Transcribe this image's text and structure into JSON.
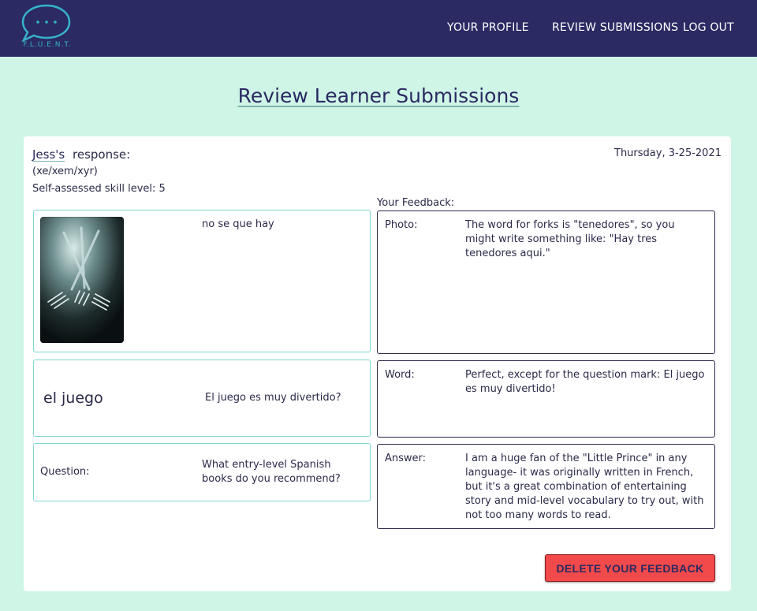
{
  "brand": {
    "logo_text": "F.L.U.E.N.T."
  },
  "nav": {
    "profile": "YOUR PROFILE",
    "review": "REVIEW SUBMISSIONS",
    "logout": "LOG OUT"
  },
  "page": {
    "title": "Review Learner Submissions"
  },
  "submission": {
    "learner_name": "Jess's",
    "response_label": "response:",
    "pronouns": "(xe/xem/xyr)",
    "skill_level": "Self-assessed skill level: 5",
    "date": "Thursday, 3-25-2021",
    "photo_caption": "no se que hay",
    "word": "el juego",
    "word_sentence": "El juego es muy divertido?",
    "question_label": "Question:",
    "question_text": "What entry-level Spanish books do you recommend?"
  },
  "feedback": {
    "heading": "Your Feedback:",
    "photo_label": "Photo:",
    "photo_text": "The word for forks is \"tenedores\", so you might write something like: \"Hay tres tenedores aqui.\"",
    "word_label": "Word:",
    "word_text": "Perfect, except for the question mark: El juego es muy divertido!",
    "answer_label": "Answer:",
    "answer_text": "I am a huge fan of the \"Little Prince\" in any language- it was originally written in French, but it's a great combination of entertaining story and mid-level vocabulary to try out, with not too many words to read."
  },
  "actions": {
    "delete_feedback": "DELETE YOUR FEEDBACK"
  },
  "colors": {
    "navbar": "#2b2a63",
    "background": "#cff5e7",
    "accent": "#36b3c9",
    "danger": "#f24a4a"
  },
  "icons": {
    "logo": "chat-bubble-icon",
    "photo": "forks-photo"
  }
}
